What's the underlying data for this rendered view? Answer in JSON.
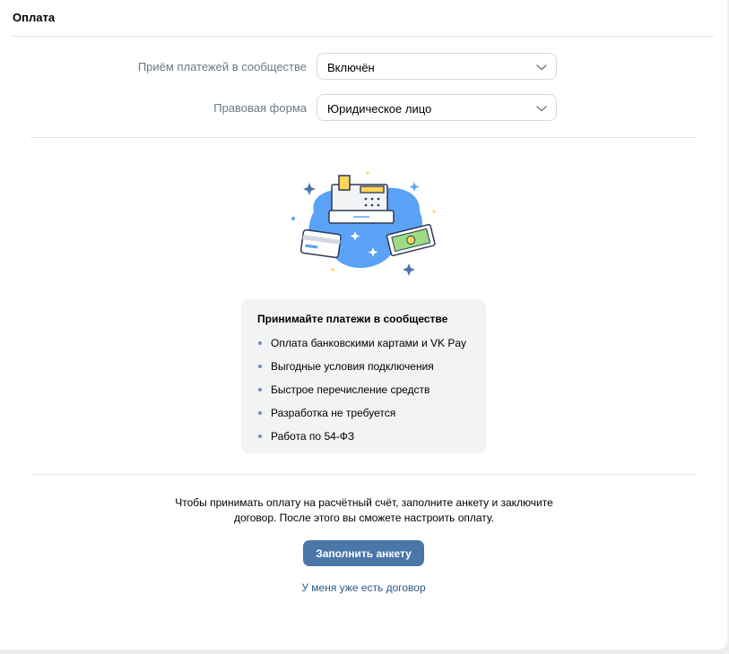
{
  "header": {
    "title": "Оплата"
  },
  "form": {
    "payments": {
      "label": "Приём платежей в сообществе",
      "value": "Включён"
    },
    "legal_form": {
      "label": "Правовая форма",
      "value": "Юридическое лицо"
    }
  },
  "benefits": {
    "title": "Принимайте платежи в сообществе",
    "items": [
      "Оплата банковскими картами и VK Pay",
      "Выгодные условия подключения",
      "Быстрое перечисление средств",
      "Разработка не требуется",
      "Работа по 54-ФЗ"
    ]
  },
  "info": {
    "line1": "Чтобы принимать оплату на расчётный счёт, заполните анкету и заключите",
    "line2": "договор. После этого вы сможете настроить оплату."
  },
  "actions": {
    "fill_form": "Заполнить анкету",
    "have_contract": "У меня уже есть договор"
  },
  "colors": {
    "accent": "#4a76a8",
    "link": "#2a5885",
    "label": "#6d7885"
  },
  "icons": {
    "select_chevron": "chevron-down-icon",
    "illustration": "cash-register-illustration"
  }
}
